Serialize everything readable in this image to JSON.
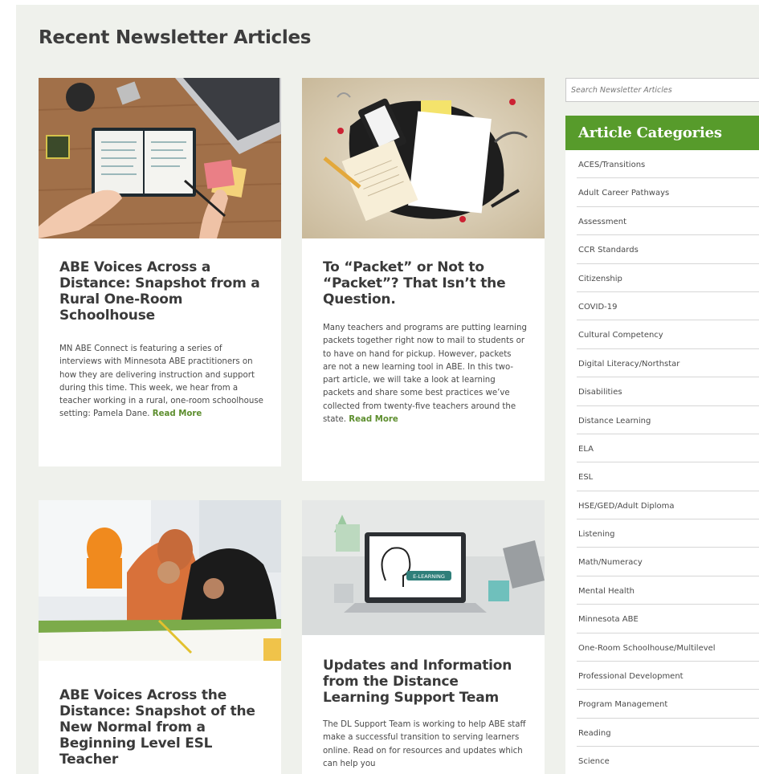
{
  "page": {
    "title": "Recent Newsletter Articles"
  },
  "articles": [
    {
      "title": "ABE Voices Across a Distance: Snapshot from a Rural One-Room Schoolhouse",
      "excerpt": "MN ABE Connect is featuring a series of interviews with Minnesota ABE practitioners on how they are delivering instruction and support during this time. This week, we hear from a teacher working in a rural, one-room schoolhouse setting: Pamela Dane.",
      "read_more": "Read More"
    },
    {
      "title": "To “Packet” or Not to “Packet”? That Isn’t the Question.",
      "excerpt": "Many teachers and programs are putting learning packets together right now to mail to students or to have on hand for pickup. However, packets are not a new learning tool in ABE. In this two-part article, we will take a look at learning packets and share some best practices we’ve collected from twenty-five teachers around the state.",
      "read_more": "Read More"
    },
    {
      "title": "ABE Voices Across the Distance: Snapshot of the New Normal from a Beginning Level ESL Teacher",
      "excerpt": "",
      "read_more": ""
    },
    {
      "title": "Updates and Information from the Distance Learning Support Team",
      "excerpt": "The DL Support Team is working to help ABE staff make a successful transition to serving learners online. Read on for resources and updates which can help you",
      "read_more": "",
      "image_text": "E-LEARNING"
    }
  ],
  "sidebar": {
    "search_placeholder": "Search Newsletter Articles",
    "categories_title": "Article Categories",
    "categories": [
      "ACES/Transitions",
      "Adult Career Pathways",
      "Assessment",
      "CCR Standards",
      "Citizenship",
      "COVID-19",
      "Cultural Competency",
      "Digital Literacy/Northstar",
      "Disabilities",
      "Distance Learning",
      "ELA",
      "ESL",
      "HSE/GED/Adult Diploma",
      "Listening",
      "Math/Numeracy",
      "Mental Health",
      "Minnesota ABE",
      "One-Room Schoolhouse/Multilevel",
      "Professional Development",
      "Program Management",
      "Reading",
      "Science"
    ]
  },
  "colors": {
    "accent": "#579b2b",
    "link": "#5d8e2e",
    "background": "#eff1ec"
  }
}
